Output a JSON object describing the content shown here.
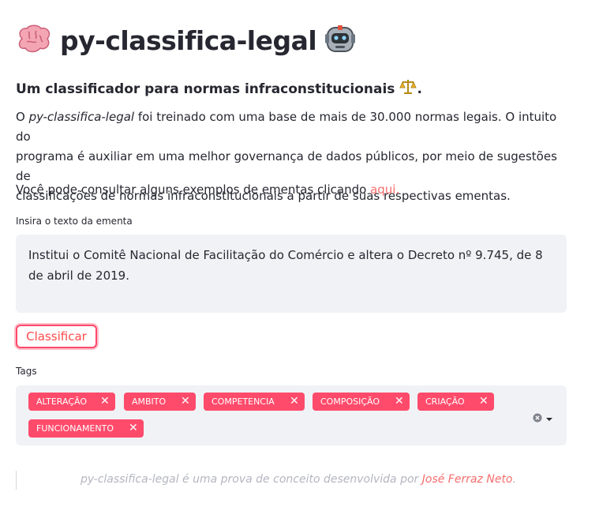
{
  "header": {
    "title": "py-classifica-legal",
    "left_icon": "brain-icon",
    "right_icon": "robot-icon"
  },
  "subtitle": "Um classificador para normas infraconstitucionais",
  "subtitle_icon": "scales-icon",
  "intro": {
    "prefix": "O ",
    "name": "py-classifica-legal",
    "line1_rest": " foi treinado com uma base de mais de 30.000 normas legais. O intuito do",
    "line2": "programa é auxiliar em uma melhor governança de dados públicos, por meio de sugestões de",
    "line3": "classificações de normas infraconstitucionais a partir de suas respectivas ementas."
  },
  "examples": {
    "text": "Você pode consultar alguns exemplos de ementas clicando ",
    "link": "aqui."
  },
  "ementa": {
    "label": "Insira o texto da ementa",
    "value": "Institui o Comitê Nacional de Facilitação do Comércio e altera o Decreto nº 9.745, de 8 de abril de 2019."
  },
  "classify_button": "Classificar",
  "tags": {
    "label": "Tags",
    "items": [
      "ALTERAÇÃO",
      "AMBITO",
      "COMPETENCIA",
      "COMPOSIÇÃO",
      "CRIAÇÃO",
      "FUNCIONAMENTO"
    ],
    "remove_glyph": "✕"
  },
  "footer": {
    "text": "py-classifica-legal é uma prova de conceito desenvolvida por ",
    "author": "José Ferraz Neto",
    "end": "."
  },
  "colors": {
    "accent": "#ff4b6b",
    "link": "#f76d6d",
    "field_bg": "#f0f2f6"
  }
}
